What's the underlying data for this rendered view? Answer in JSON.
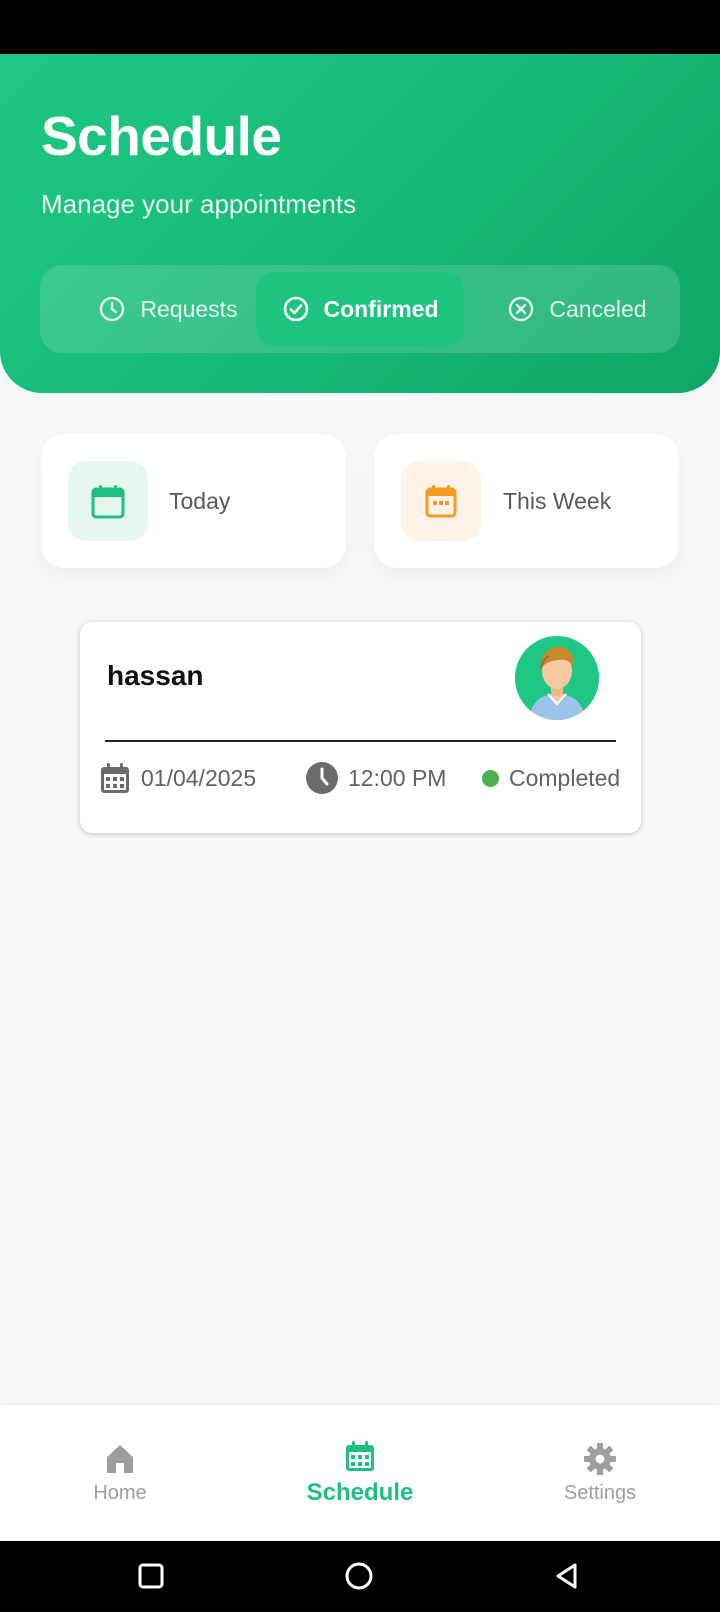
{
  "header": {
    "title": "Schedule",
    "subtitle": "Manage your appointments"
  },
  "tabs": [
    {
      "label": "Requests",
      "icon": "clock-icon",
      "active": false
    },
    {
      "label": "Confirmed",
      "icon": "check-circle-icon",
      "active": true
    },
    {
      "label": "Canceled",
      "icon": "x-circle-icon",
      "active": false
    }
  ],
  "stats": [
    {
      "label": "Today",
      "icon": "calendar-icon",
      "color": "#1ec07f"
    },
    {
      "label": "This Week",
      "icon": "calendar-grid-icon",
      "color": "#f59a23"
    }
  ],
  "appointment": {
    "name": "hassan",
    "date": "01/04/2025",
    "time": "12:00 PM",
    "status": "Completed",
    "status_color": "#4caf50"
  },
  "bottom_nav": [
    {
      "label": "Home",
      "icon": "home-icon",
      "active": false
    },
    {
      "label": "Schedule",
      "icon": "calendar-icon",
      "active": true
    },
    {
      "label": "Settings",
      "icon": "gear-icon",
      "active": false
    }
  ],
  "colors": {
    "brand": "#1ec884",
    "active_nav": "#1ec07f",
    "inactive_nav": "#9e9e9e"
  }
}
